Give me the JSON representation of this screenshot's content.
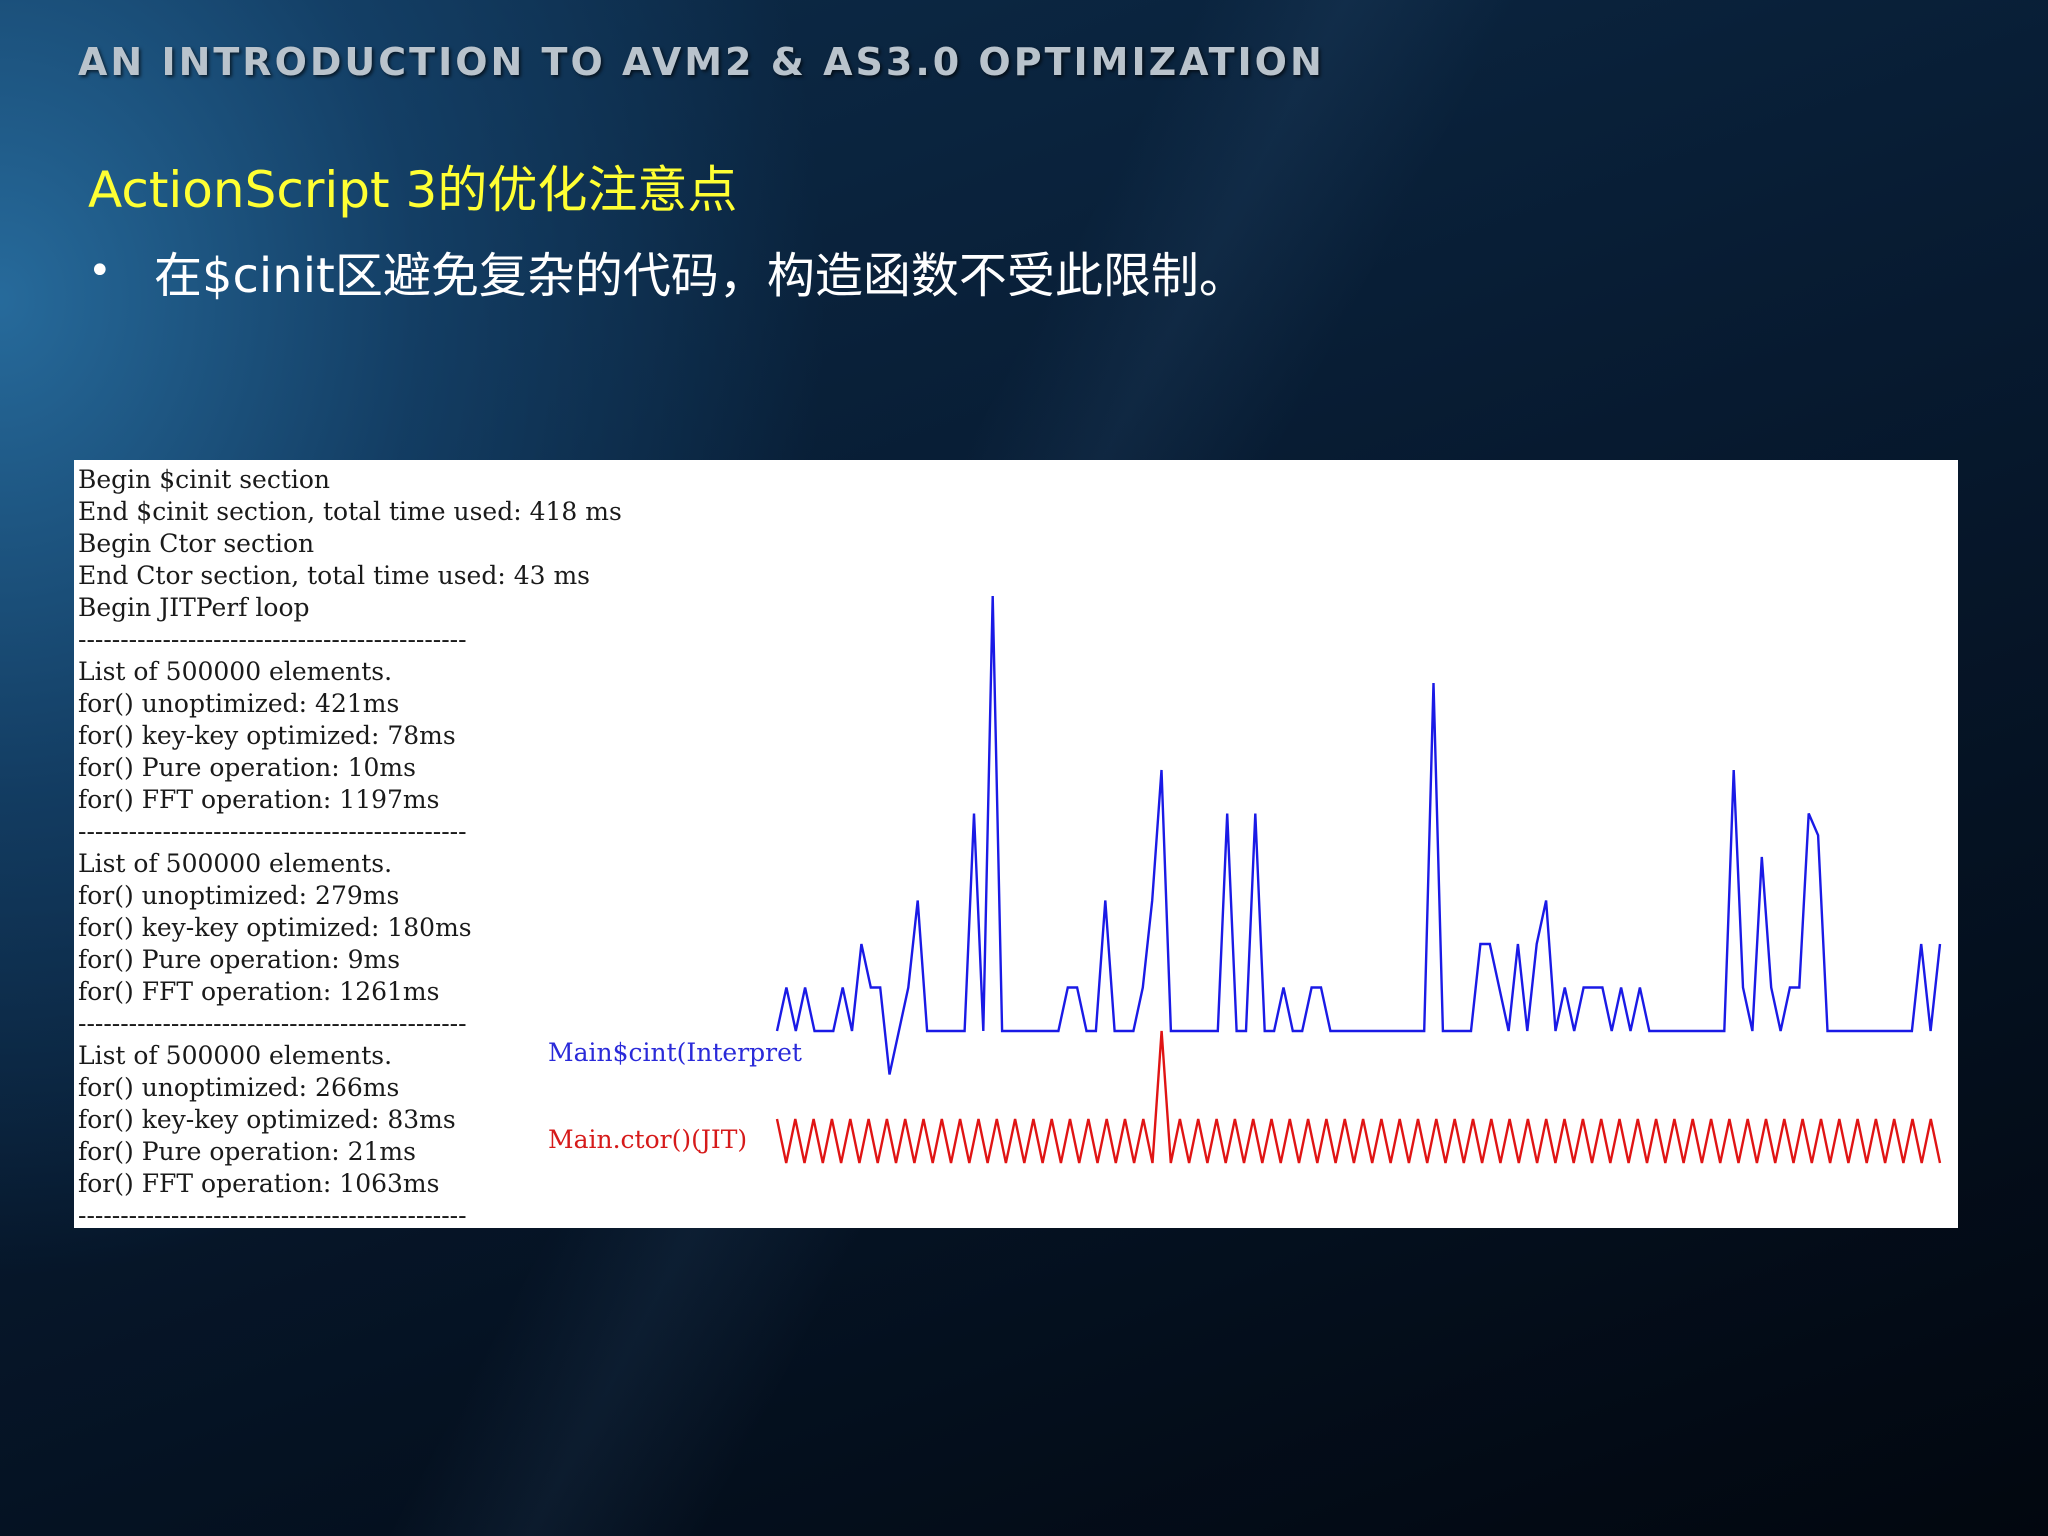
{
  "slide": {
    "header": "AN INTRODUCTION TO AVM2 & AS3.0 OPTIMIZATION",
    "subtitle": "ActionScript 3的优化注意点",
    "bullet": "在$cinit区避免复杂的代码，构造函数不受此限制。"
  },
  "log": {
    "lines": [
      "Begin $cinit section",
      "End $cinit section, total time used: 418 ms",
      "Begin Ctor section",
      "End Ctor section, total time used: 43 ms",
      "Begin JITPerf loop",
      "----------------------------------------------",
      "List of 500000 elements.",
      "for() unoptimized: 421ms",
      "for() key-key optimized: 78ms",
      "for() Pure operation: 10ms",
      "for() FFT operation: 1197ms",
      "----------------------------------------------",
      "List of 500000 elements.",
      "for() unoptimized: 279ms",
      "for() key-key optimized: 180ms",
      "for() Pure operation: 9ms",
      "for() FFT operation: 1261ms",
      "----------------------------------------------",
      "List of 500000 elements.",
      "for() unoptimized: 266ms",
      "for() key-key optimized: 83ms",
      "for() Pure operation: 21ms",
      "for() FFT operation: 1063ms",
      "----------------------------------------------"
    ]
  },
  "chart_data": {
    "type": "line",
    "series": [
      {
        "name": "Main$cint(Interpret",
        "color": "#1a1ae6",
        "values": [
          0,
          1,
          0,
          1,
          0,
          0,
          0,
          1,
          0,
          2,
          1,
          1,
          -1,
          0,
          1,
          3,
          0,
          0,
          0,
          0,
          0,
          5,
          0,
          10,
          0,
          0,
          0,
          0,
          0,
          0,
          0,
          1,
          1,
          0,
          0,
          3,
          0,
          0,
          0,
          1,
          3,
          6,
          0,
          0,
          0,
          0,
          0,
          0,
          5,
          0,
          0,
          5,
          0,
          0,
          1,
          0,
          0,
          1,
          1,
          0,
          0,
          0,
          0,
          0,
          0,
          0,
          0,
          0,
          0,
          0,
          8,
          0,
          0,
          0,
          0,
          2,
          2,
          1,
          0,
          2,
          0,
          2,
          3,
          0,
          1,
          0,
          1,
          1,
          1,
          0,
          1,
          0,
          1,
          0,
          0,
          0,
          0,
          0,
          0,
          0,
          0,
          0,
          6,
          1,
          0,
          4,
          1,
          0,
          1,
          1,
          5,
          4.5,
          0,
          0,
          0,
          0,
          0,
          0,
          0,
          0,
          0,
          0,
          2,
          0,
          2
        ]
      },
      {
        "name": "Main.ctor()(JIT)",
        "color": "#e01414",
        "values": [
          1,
          0,
          1,
          0,
          1,
          0,
          1,
          0,
          1,
          0,
          1,
          0,
          1,
          0,
          1,
          0,
          1,
          0,
          1,
          0,
          1,
          0,
          1,
          0,
          1,
          0,
          1,
          0,
          1,
          0,
          1,
          0,
          1,
          0,
          1,
          0,
          1,
          0,
          1,
          0,
          1,
          0,
          3,
          0,
          1,
          0,
          1,
          0,
          1,
          0,
          1,
          0,
          1,
          0,
          1,
          0,
          1,
          0,
          1,
          0,
          1,
          0,
          1,
          0,
          1,
          0,
          1,
          0,
          1,
          0,
          1,
          0,
          1,
          0,
          1,
          0,
          1,
          0,
          1,
          0,
          1,
          0,
          1,
          0,
          1,
          0,
          1,
          0,
          1,
          0,
          1,
          0,
          1,
          0,
          1,
          0,
          1,
          0,
          1,
          0,
          1,
          0,
          1,
          0,
          1,
          0,
          1,
          0,
          1,
          0,
          1,
          0,
          1,
          0,
          1,
          0,
          1,
          0,
          1,
          0,
          1,
          0,
          1,
          0,
          1,
          0,
          1,
          0
        ]
      }
    ]
  }
}
